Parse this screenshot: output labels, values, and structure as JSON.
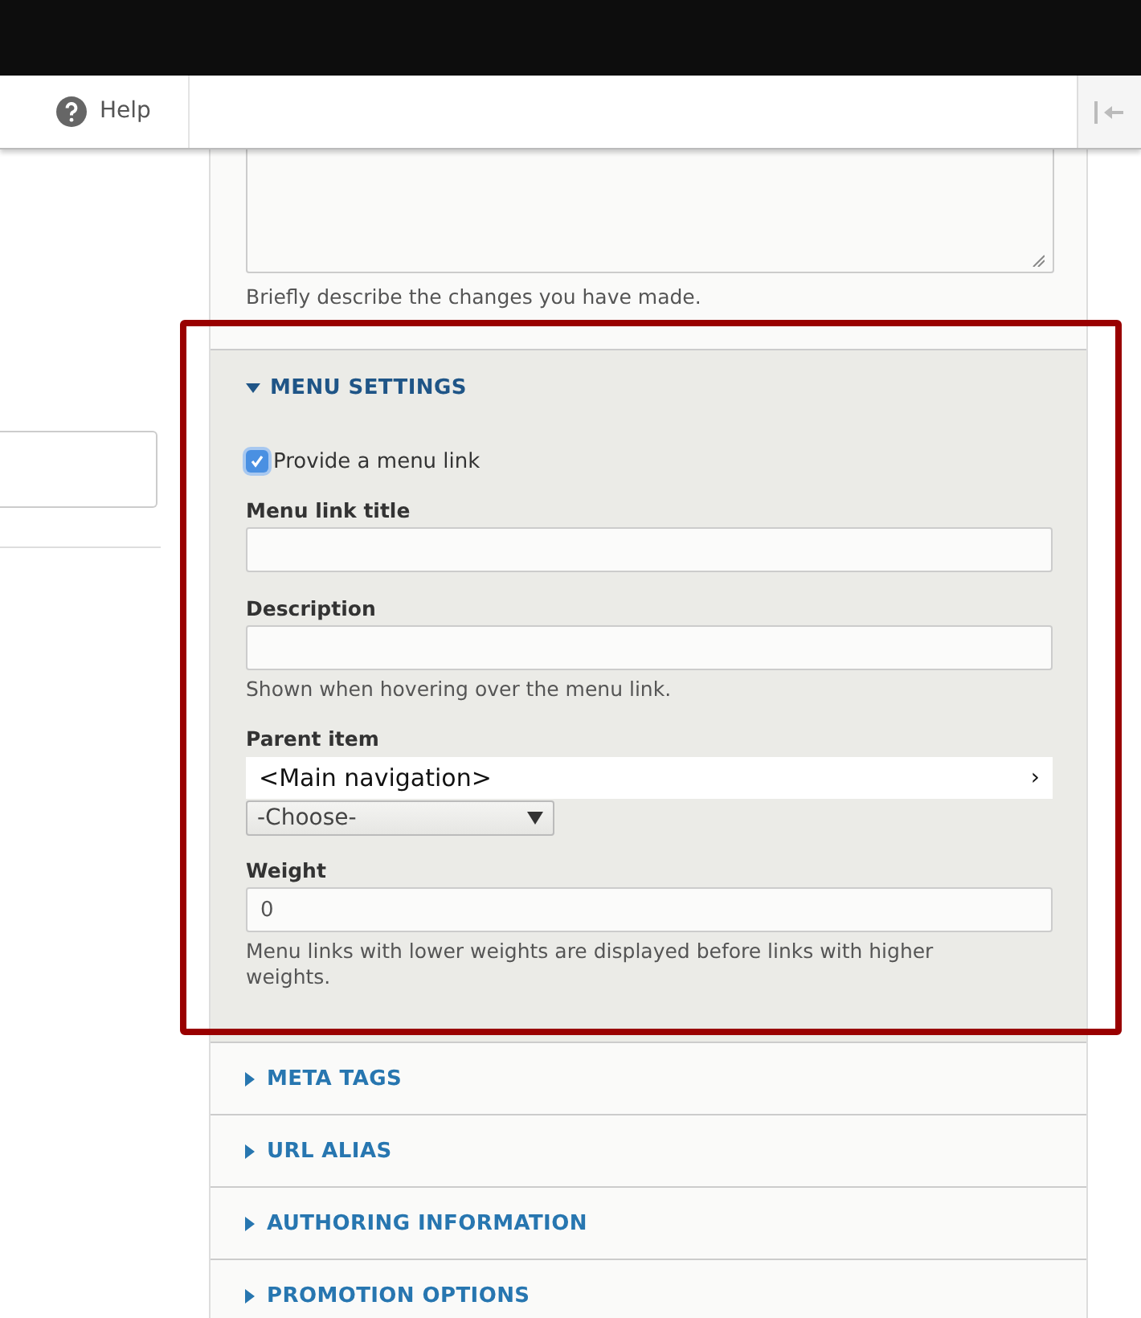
{
  "toolbar": {
    "help": "Help"
  },
  "revision_log": {
    "help": "Briefly describe the changes you have made."
  },
  "menu_settings": {
    "title": "MENU SETTINGS",
    "expanded": true,
    "provide_link": {
      "label": "Provide a menu link",
      "checked": true
    },
    "link_title": {
      "label": "Menu link title"
    },
    "description": {
      "label": "Description",
      "help": "Shown when hovering over the menu link."
    },
    "parent_item": {
      "label": "Parent item",
      "value": "<Main navigation>",
      "arrow": "›",
      "select": "-Choose-"
    },
    "weight": {
      "label": "Weight",
      "value": "0",
      "help": "Menu links with lower weights are displayed before links with higher weights."
    }
  },
  "sections": [
    {
      "title": "META TAGS",
      "expanded": false
    },
    {
      "title": "URL ALIAS",
      "expanded": false
    },
    {
      "title": "AUTHORING INFORMATION",
      "expanded": false
    },
    {
      "title": "PROMOTION OPTIONS",
      "expanded": false
    }
  ]
}
